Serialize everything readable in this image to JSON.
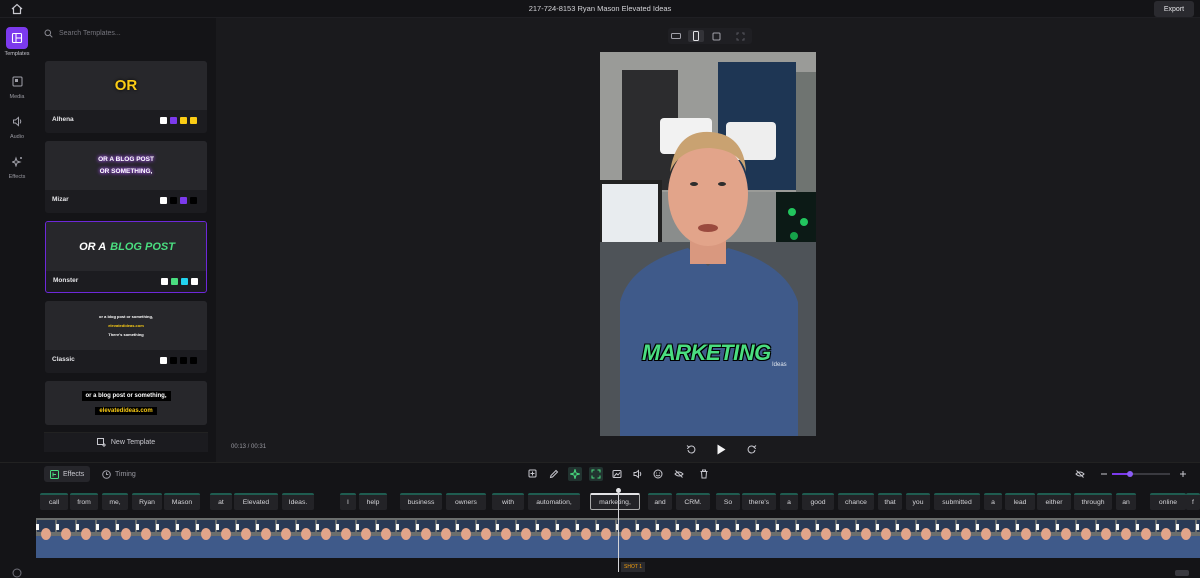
{
  "header": {
    "title": "217-724-8153 Ryan Mason Elevated Ideas",
    "export_label": "Export"
  },
  "rail": [
    {
      "label": "Templates",
      "icon": "templates-icon",
      "active": true
    },
    {
      "label": "Media",
      "icon": "media-icon"
    },
    {
      "label": "Audio",
      "icon": "audio-icon"
    },
    {
      "label": "Effects",
      "icon": "effects-icon"
    }
  ],
  "templates": {
    "search_placeholder": "Search Templates...",
    "new_template_label": "New Template",
    "cards": [
      {
        "name": "Alhena",
        "preview": [
          "OR"
        ],
        "swatches": [
          "#ffffff",
          "#7c3aed",
          "#facc15",
          "#facc15"
        ]
      },
      {
        "name": "Mizar",
        "preview": [
          "OR A BLOG POST",
          "OR SOMETHING,"
        ],
        "swatches": [
          "#ffffff",
          "#000000",
          "#7c3aed",
          "#000000"
        ]
      },
      {
        "name": "Monster",
        "preview": [
          "OR A",
          "BLOG POST"
        ],
        "swatches": [
          "#ffffff",
          "#4ade80",
          "#22d3ee",
          "#ffffff"
        ]
      },
      {
        "name": "Classic",
        "preview": [
          "or a blog post or something,",
          "elevatedideas.com",
          "There's something"
        ],
        "swatches": [
          "#ffffff",
          "#000000",
          "#000000",
          "#000000"
        ]
      },
      {
        "name": "",
        "preview": [
          "or a blog post or something,",
          "elevatedideas.com"
        ],
        "swatches": []
      }
    ]
  },
  "preview": {
    "caption_overlay": "MARKETING",
    "shirt_text": "Ideas"
  },
  "playback": {
    "time": "00:13 / 00:31"
  },
  "toolbar": {
    "effects_label": "Effects",
    "timing_label": "Timing"
  },
  "captions": [
    "call",
    "from",
    "me,",
    "Ryan",
    "Mason",
    "at",
    "Elevated",
    "Ideas.",
    "I",
    "help",
    "business",
    "owners",
    "with",
    "automation,",
    "marketing,",
    "and",
    "CRM.",
    "So",
    "there's",
    "a",
    "good",
    "chance",
    "that",
    "you",
    "submitted",
    "a",
    "lead",
    "either",
    "through",
    "an",
    "online",
    "f"
  ],
  "timeline": {
    "shot_label": "SHOT 1"
  },
  "colors": {
    "accent": "#7c3aed",
    "caption_green": "#4ade80"
  }
}
